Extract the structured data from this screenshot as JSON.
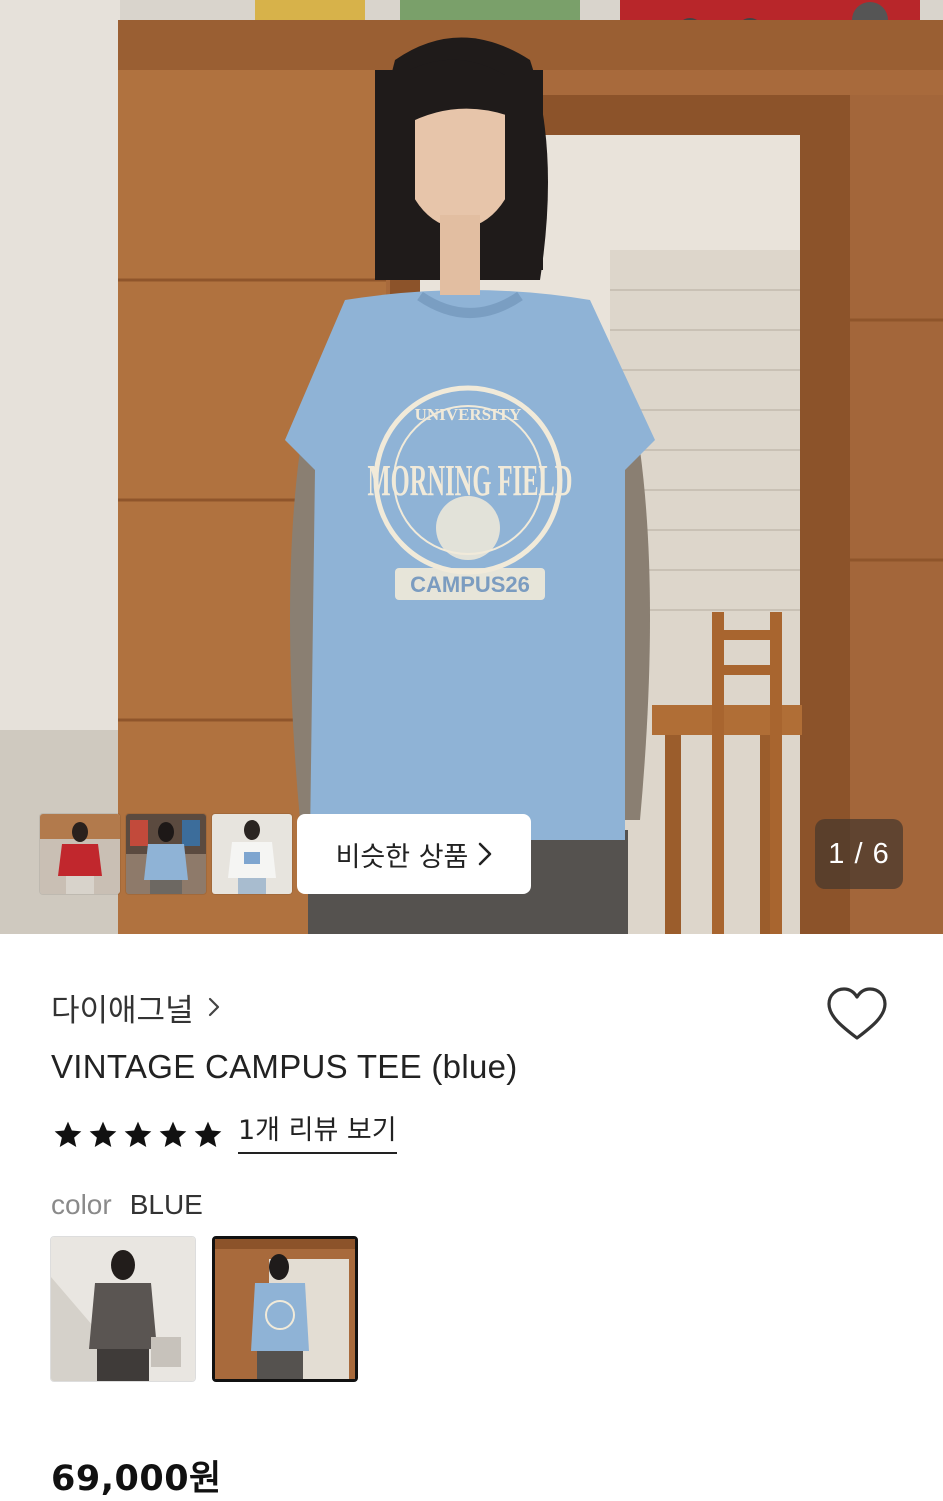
{
  "gallery": {
    "similar_products_label": "비슷한 상품",
    "counter": "1 / 6",
    "thumbnails": [
      "red tee thumbnail",
      "blue tee thumbnail",
      "white tee thumbnail"
    ]
  },
  "shirt_print": {
    "arc_top": "UNIVERSITY",
    "main": "MORNING FIELD",
    "ribbon": "CAMPUS26"
  },
  "product": {
    "brand": "다이애그널",
    "name": "VINTAGE CAMPUS TEE (blue)",
    "rating_stars": 5,
    "review_link": "1개 리뷰 보기",
    "color_label": "color",
    "color_value": "BLUE",
    "price": "69,000원"
  },
  "colors": {
    "accent": "#111111",
    "muted_text": "#8a8a8a",
    "tee_blue": "#8fb3d6"
  },
  "icons": {
    "heart": "heart-outline-icon",
    "chevron": "chevron-right-icon",
    "star": "star-filled-icon"
  }
}
